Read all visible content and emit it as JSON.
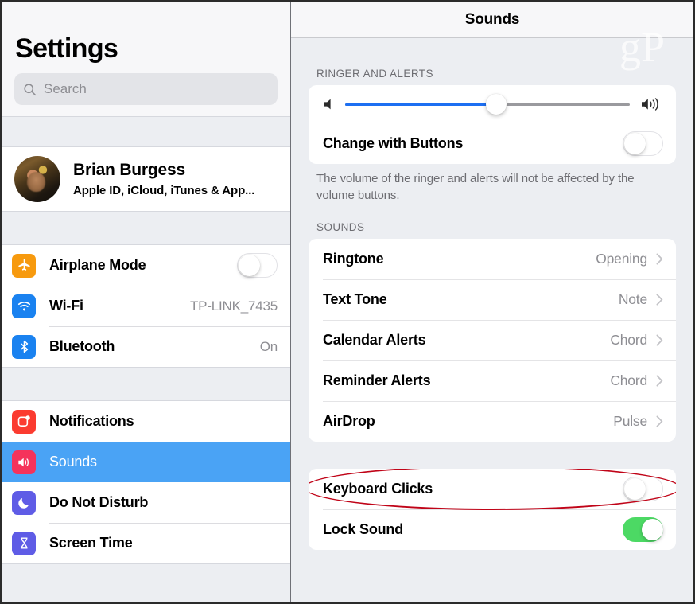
{
  "sidebar": {
    "title": "Settings",
    "search": {
      "placeholder": "Search",
      "icon": "search-icon"
    },
    "account": {
      "name": "Brian Burgess",
      "subtitle": "Apple ID, iCloud, iTunes & App...",
      "avatar_icon": "avatar"
    },
    "groups": [
      {
        "items": [
          {
            "label": "Airplane Mode",
            "icon": "airplane-icon",
            "icon_color": "#f79a0e",
            "control": "toggle",
            "toggle_on": false
          },
          {
            "label": "Wi-Fi",
            "icon": "wifi-icon",
            "icon_color": "#1a82f0",
            "control": "value",
            "value": "TP-LINK_7435"
          },
          {
            "label": "Bluetooth",
            "icon": "bluetooth-icon",
            "icon_color": "#1a82f0",
            "control": "value",
            "value": "On"
          }
        ]
      },
      {
        "items": [
          {
            "label": "Notifications",
            "icon": "notifications-icon",
            "icon_color": "#fb3b30",
            "control": "none",
            "selected": false
          },
          {
            "label": "Sounds",
            "icon": "sounds-icon",
            "icon_color": "#f5335b",
            "control": "none",
            "selected": true
          },
          {
            "label": "Do Not Disturb",
            "icon": "moon-icon",
            "icon_color": "#5f5ce6",
            "control": "none",
            "selected": false
          },
          {
            "label": "Screen Time",
            "icon": "hourglass-icon",
            "icon_color": "#5f5ce6",
            "control": "none",
            "selected": false
          }
        ]
      }
    ]
  },
  "detail": {
    "title": "Sounds",
    "watermark": "gP",
    "ringer_section": {
      "label": "RINGER AND ALERTS",
      "slider": {
        "value_percent": 53,
        "min_icon": "speaker-low-icon",
        "max_icon": "speaker-high-icon",
        "fill_color": "#1d6ff2",
        "track_color": "#9a9a9e"
      },
      "change_with_buttons": {
        "label": "Change with Buttons",
        "toggle_on": false
      },
      "footnote": "The volume of the ringer and alerts will not be affected by the volume buttons."
    },
    "sounds_section": {
      "label": "SOUNDS",
      "rows": [
        {
          "label": "Ringtone",
          "value": "Opening"
        },
        {
          "label": "Text Tone",
          "value": "Note"
        },
        {
          "label": "Calendar Alerts",
          "value": "Chord"
        },
        {
          "label": "Reminder Alerts",
          "value": "Chord"
        },
        {
          "label": "AirDrop",
          "value": "Pulse"
        }
      ]
    },
    "bottom_section": {
      "rows": [
        {
          "label": "Keyboard Clicks",
          "toggle_on": false,
          "annotated": true
        },
        {
          "label": "Lock Sound",
          "toggle_on": true,
          "annotated": false
        }
      ],
      "annotation_color": "#c00418"
    }
  }
}
